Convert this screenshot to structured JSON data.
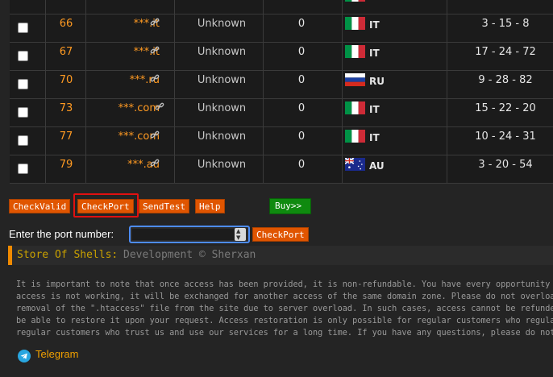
{
  "table": {
    "rows": [
      {
        "id": "",
        "domain": "",
        "status": "",
        "count": "",
        "country": "IT",
        "stats": "",
        "flag": "it"
      },
      {
        "id": "66",
        "domain": "***.it",
        "status": "Unknown",
        "count": "0",
        "country": "IT",
        "stats": "3 - 15 - 8",
        "flag": "it"
      },
      {
        "id": "67",
        "domain": "***.it",
        "status": "Unknown",
        "count": "0",
        "country": "IT",
        "stats": "17 - 24 - 72",
        "flag": "it"
      },
      {
        "id": "70",
        "domain": "***.ru",
        "status": "Unknown",
        "count": "0",
        "country": "RU",
        "stats": "9 - 28 - 82",
        "flag": "ru"
      },
      {
        "id": "73",
        "domain": "***.com",
        "status": "Unknown",
        "count": "0",
        "country": "IT",
        "stats": "15 - 22 - 20",
        "flag": "it"
      },
      {
        "id": "77",
        "domain": "***.com",
        "status": "Unknown",
        "count": "0",
        "country": "IT",
        "stats": "10 - 24 - 31",
        "flag": "it"
      },
      {
        "id": "79",
        "domain": "***.au",
        "status": "Unknown",
        "count": "0",
        "country": "AU",
        "stats": "3 - 20 - 54",
        "flag": "au"
      }
    ]
  },
  "actions": {
    "check_valid": "CheckValid",
    "check_port": "CheckPort",
    "send_test": "SendTest",
    "help": "Help",
    "buy": "Buy>>"
  },
  "port": {
    "label": "Enter the port number:",
    "value": "",
    "submit": "CheckPort"
  },
  "store": {
    "title": "Store Of Shells:",
    "subtitle": "Development © Sherxan"
  },
  "notice": {
    "lines": [
      "It is important to note that once access has been provided, it is non-refundable. You have every opportunity to",
      "access is not working, it will be exchanged for another access of the same domain zone. Please do not overload",
      "removal of the \".htaccess\" file from the site due to server overload. In such cases, access cannot be refunded.",
      "be able to restore it upon your request. Access restoration is only possible for regular customers who regularl",
      "regular customers who trust us and use our services for a long time. If you have any questions, please do not h"
    ]
  },
  "footer": {
    "telegram": "Telegram"
  },
  "colors": {
    "accent": "#e05500",
    "link": "#ff9a22",
    "buy": "#0f8a0f",
    "highlight": "#e01010",
    "focus": "#4d8cf5"
  }
}
